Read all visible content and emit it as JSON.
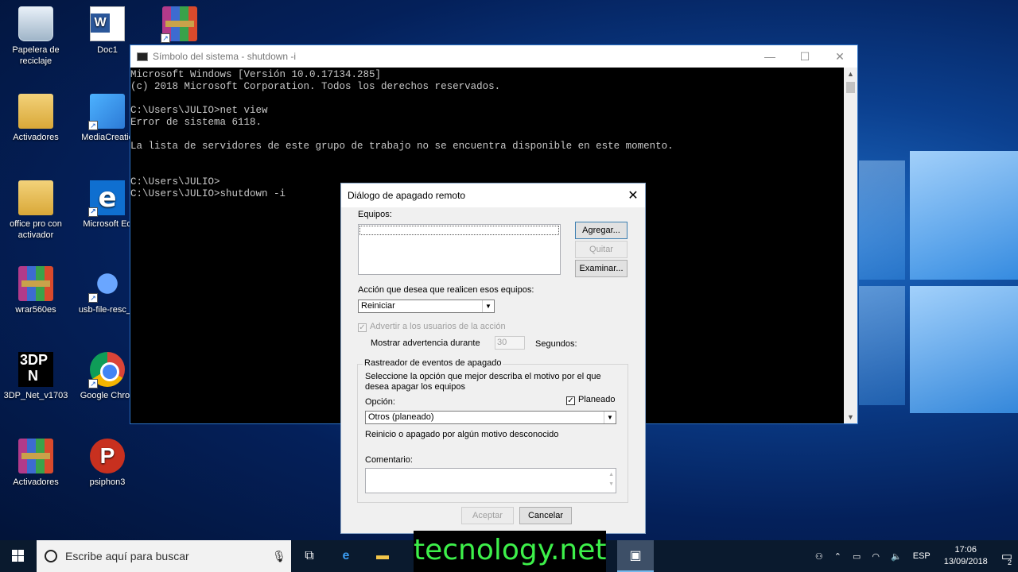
{
  "desktop": {
    "icons": [
      {
        "label": "Papelera de reciclaje"
      },
      {
        "label": "Doc1"
      },
      {
        "label": ""
      },
      {
        "label": "Activadores"
      },
      {
        "label": "MediaCreatio"
      },
      {
        "label": "office pro con activador"
      },
      {
        "label": "Microsoft Ed"
      },
      {
        "label": "wrar560es"
      },
      {
        "label": "usb-file-resc_1"
      },
      {
        "label": "3DP_Net_v1703"
      },
      {
        "label": "Google Chron"
      },
      {
        "label": "Activadores"
      },
      {
        "label": "psiphon3"
      }
    ]
  },
  "console": {
    "title": "Símbolo del sistema - shutdown  -i",
    "text": "Microsoft Windows [Versión 10.0.17134.285]\n(c) 2018 Microsoft Corporation. Todos los derechos reservados.\n\nC:\\Users\\JULIO>net view\nError de sistema 6118.\n\nLa lista de servidores de este grupo de trabajo no se encuentra disponible en este momento.\n\n\nC:\\Users\\JULIO>\nC:\\Users\\JULIO>shutdown -i",
    "minimize": "—",
    "maximize": "☐",
    "close": "✕"
  },
  "dialog": {
    "title": "Diálogo de apagado remoto",
    "close": "✕",
    "equipos_label": "Equipos:",
    "agregar": "Agregar...",
    "quitar": "Quitar",
    "examinar": "Examinar...",
    "accion_label": "Acción que desea que realicen esos equipos:",
    "accion_value": "Reiniciar",
    "advertir_label": "Advertir a los usuarios de la acción",
    "advertir_checked": true,
    "mostrar_label": "Mostrar advertencia durante",
    "segundos_value": "30",
    "segundos_label": "Segundos:",
    "rastreador_title": "Rastreador de eventos de apagado",
    "rastreador_desc": "Seleccione la opción que mejor describa el motivo por el que desea apagar los equipos",
    "opcion_label": "Opción:",
    "planeado_label": "Planeado",
    "planeado_checked": true,
    "opcion_value": "Otros (planeado)",
    "motivo_text": "Reinicio o apagado por algún motivo desconocido",
    "comentario_label": "Comentario:",
    "aceptar": "Aceptar",
    "cancelar": "Cancelar"
  },
  "taskbar": {
    "search_placeholder": "Escribe aquí para buscar",
    "language": "ESP",
    "time": "17:06",
    "date": "13/09/2018",
    "notifications": "2"
  },
  "watermark": "tecnology.net"
}
